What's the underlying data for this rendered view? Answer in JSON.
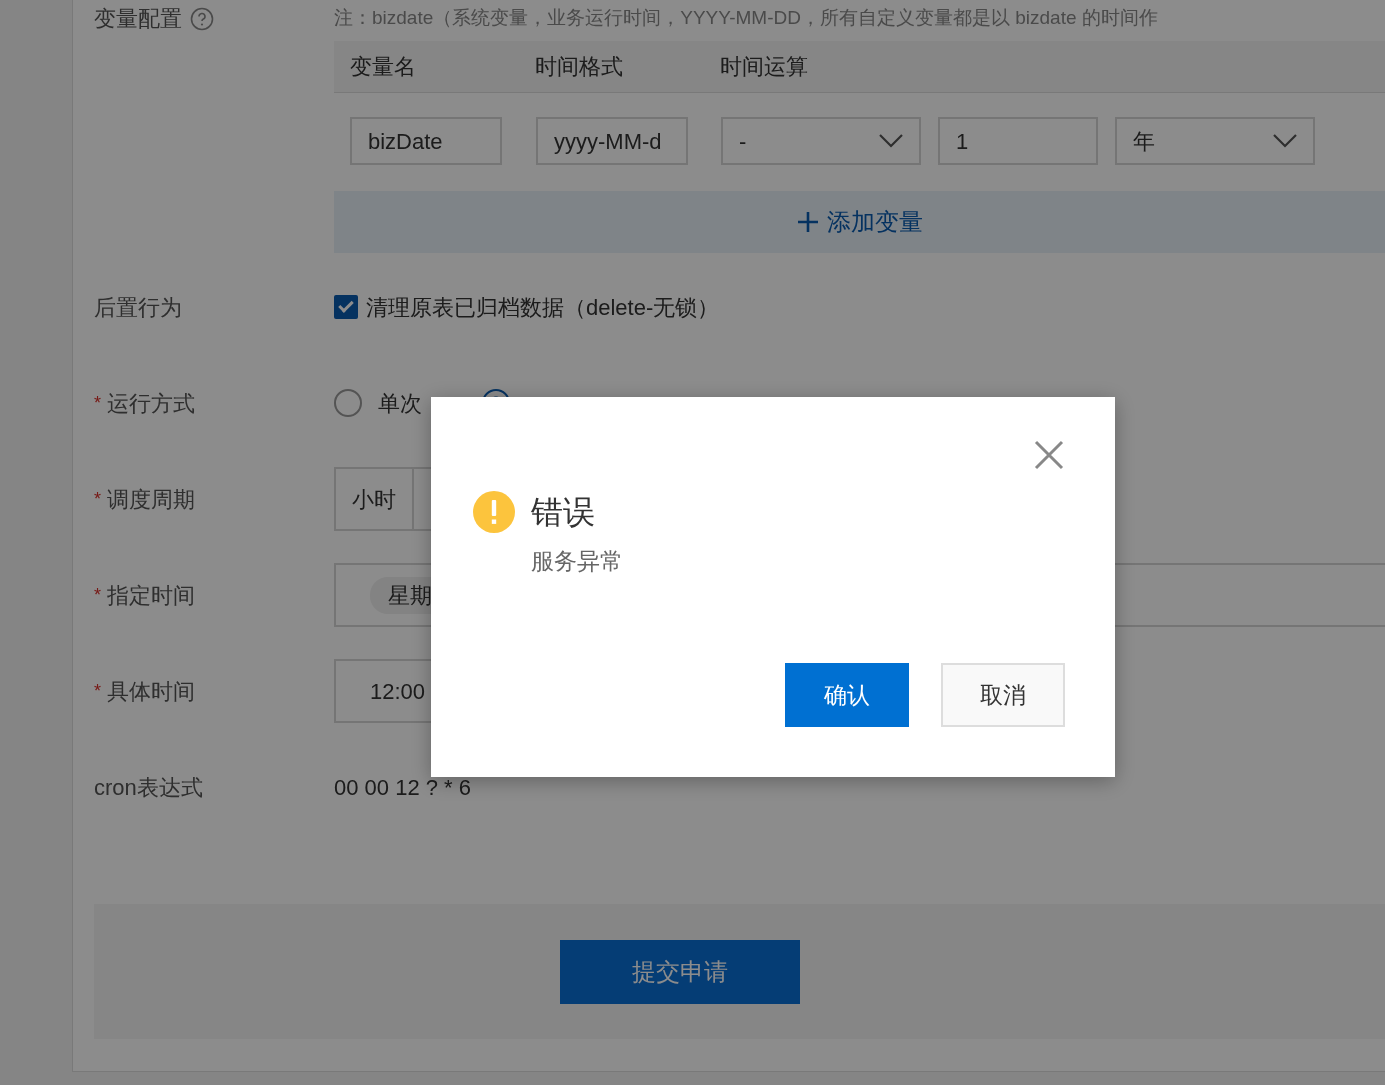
{
  "variables": {
    "label": "变量配置",
    "note": "注：bizdate（系统变量，业务运行时间，YYYY-MM-DD，所有自定义变量都是以 bizdate 的时间作",
    "columns": [
      "变量名",
      "时间格式",
      "时间运算"
    ],
    "rows": [
      {
        "name": "bizDate",
        "format": "yyyy-MM-d",
        "op": "-",
        "amount": "1",
        "unit": "年"
      }
    ],
    "add_button": "添加变量"
  },
  "fields": [
    {
      "kind": "checkbox",
      "label": "后置行为",
      "checkbox": {
        "label": "清理原表已归档数据（delete-无锁）",
        "checked": true
      }
    },
    {
      "kind": "radio",
      "label": "运行方式",
      "required_mark": "*",
      "options": [
        {
          "label": "单次",
          "selected": false
        },
        {
          "selected": true
        }
      ]
    },
    {
      "kind": "segments",
      "label": "调度周期",
      "required_mark": "*",
      "options": [
        "小时"
      ]
    },
    {
      "kind": "tags",
      "label": "指定时间",
      "required_mark": "*",
      "tags": [
        "星期"
      ]
    },
    {
      "kind": "input",
      "label": "具体时间",
      "required_mark": "*",
      "value": "12:00"
    },
    {
      "kind": "text",
      "label": "cron表达式",
      "value": "00 00 12 ? * 6"
    }
  ],
  "submit": "提交申请",
  "dialog": {
    "title": "错误",
    "message": "服务异常",
    "buttons": [
      {
        "label": "确认",
        "kind": "primary"
      },
      {
        "label": "取消",
        "kind": "default"
      }
    ]
  }
}
